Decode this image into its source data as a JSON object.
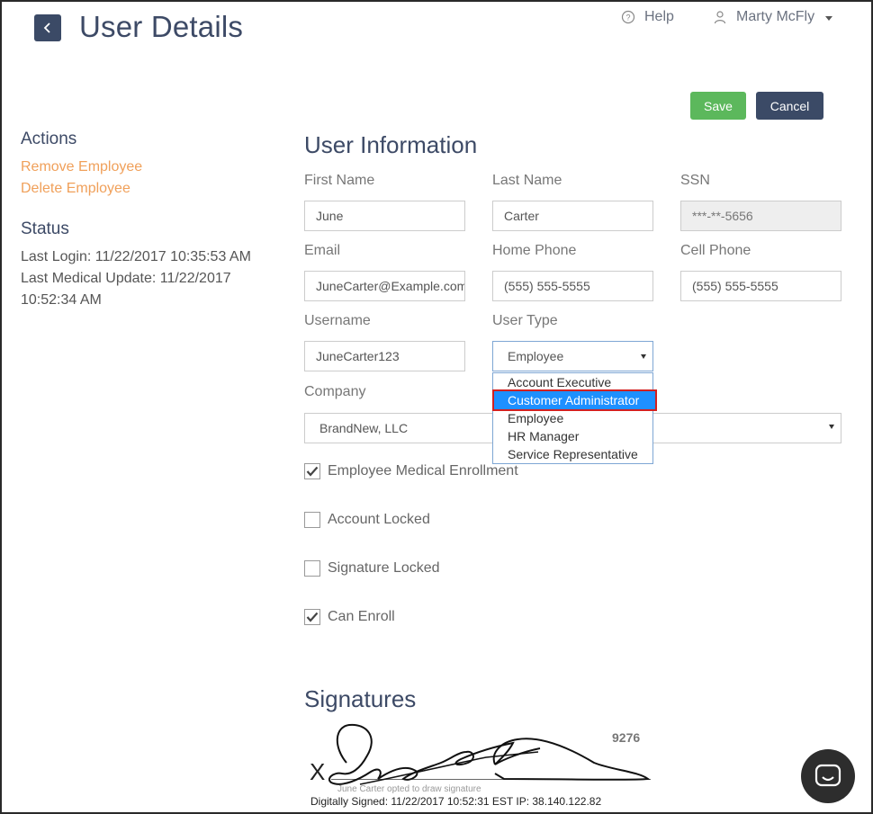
{
  "header": {
    "title": "User Details",
    "help_label": "Help",
    "user_name": "Marty McFly"
  },
  "toolbar": {
    "save_label": "Save",
    "cancel_label": "Cancel"
  },
  "sidebar": {
    "actions_heading": "Actions",
    "actions": [
      "Remove Employee",
      "Delete Employee"
    ],
    "status_heading": "Status",
    "last_login": "Last Login: 11/22/2017 10:35:53 AM",
    "last_medical_update": "Last Medical Update: 11/22/2017 10:52:34 AM"
  },
  "form": {
    "section_title": "User Information",
    "first_name": {
      "label": "First Name",
      "value": "June"
    },
    "last_name": {
      "label": "Last Name",
      "value": "Carter"
    },
    "ssn": {
      "label": "SSN",
      "value": "***-**-5656"
    },
    "email": {
      "label": "Email",
      "value": "JuneCarter@Example.com"
    },
    "home_phone": {
      "label": "Home Phone",
      "value": "(555) 555-5555"
    },
    "cell_phone": {
      "label": "Cell Phone",
      "value": "(555) 555-5555"
    },
    "username": {
      "label": "Username",
      "value": "JuneCarter123"
    },
    "user_type": {
      "label": "User Type",
      "value": "Employee",
      "options": [
        "Account Executive",
        "Customer Administrator",
        "Employee",
        "HR Manager",
        "Service Representative"
      ],
      "highlighted_option": "Customer Administrator"
    },
    "company": {
      "label": "Company",
      "value": "BrandNew, LLC"
    },
    "checkboxes": [
      {
        "label": "Employee Medical Enrollment",
        "checked": true
      },
      {
        "label": "Account Locked",
        "checked": false
      },
      {
        "label": "Signature Locked",
        "checked": false
      },
      {
        "label": "Can Enroll",
        "checked": true
      }
    ]
  },
  "signatures": {
    "title": "Signatures",
    "x_mark": "X",
    "number": "9276",
    "note": "June Carter opted to draw signature",
    "signed_text": "Digitally Signed: 11/22/2017 10:52:31 EST IP: 38.140.122.82"
  },
  "colors": {
    "primary": "#3b4a66",
    "save": "#5cb85c",
    "link": "#f0a05a",
    "highlight": "#1e90ff",
    "highlight_border": "#d32020"
  },
  "icons": {
    "back": "chevron-left-icon",
    "help": "question-circle-icon",
    "user": "user-icon",
    "chat": "chat-icon"
  }
}
